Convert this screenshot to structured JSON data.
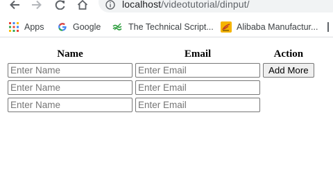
{
  "browser": {
    "url_host": "localhost",
    "url_path": "/videotutorial/dinput/",
    "icons": {
      "back": "back-arrow-icon",
      "forward": "forward-arrow-icon",
      "reload": "reload-icon",
      "home": "home-icon",
      "site_info": "info-icon"
    }
  },
  "bookmarks": [
    {
      "label": "Apps",
      "icon": "apps-grid-icon"
    },
    {
      "label": "Google",
      "icon": "google-icon"
    },
    {
      "label": "The Technical Script...",
      "icon": "technical-script-icon"
    },
    {
      "label": "Alibaba Manufactur...",
      "icon": "alibaba-icon"
    }
  ],
  "form": {
    "headers": {
      "name": "Name",
      "email": "Email",
      "action": "Action"
    },
    "rows": [
      {
        "name_placeholder": "Enter Name",
        "email_placeholder": "Enter Email",
        "name_value": "",
        "email_value": ""
      },
      {
        "name_placeholder": "Enter Name",
        "email_placeholder": "Enter Email",
        "name_value": "",
        "email_value": ""
      },
      {
        "name_placeholder": "Enter Name",
        "email_placeholder": "Enter Email",
        "name_value": "",
        "email_value": ""
      }
    ],
    "add_more_label": "Add More"
  },
  "colors": {
    "chrome_icon": "#5f6368",
    "omnibox_bg": "#f1f3f4",
    "input_border": "#767676",
    "button_bg": "#efefef"
  }
}
